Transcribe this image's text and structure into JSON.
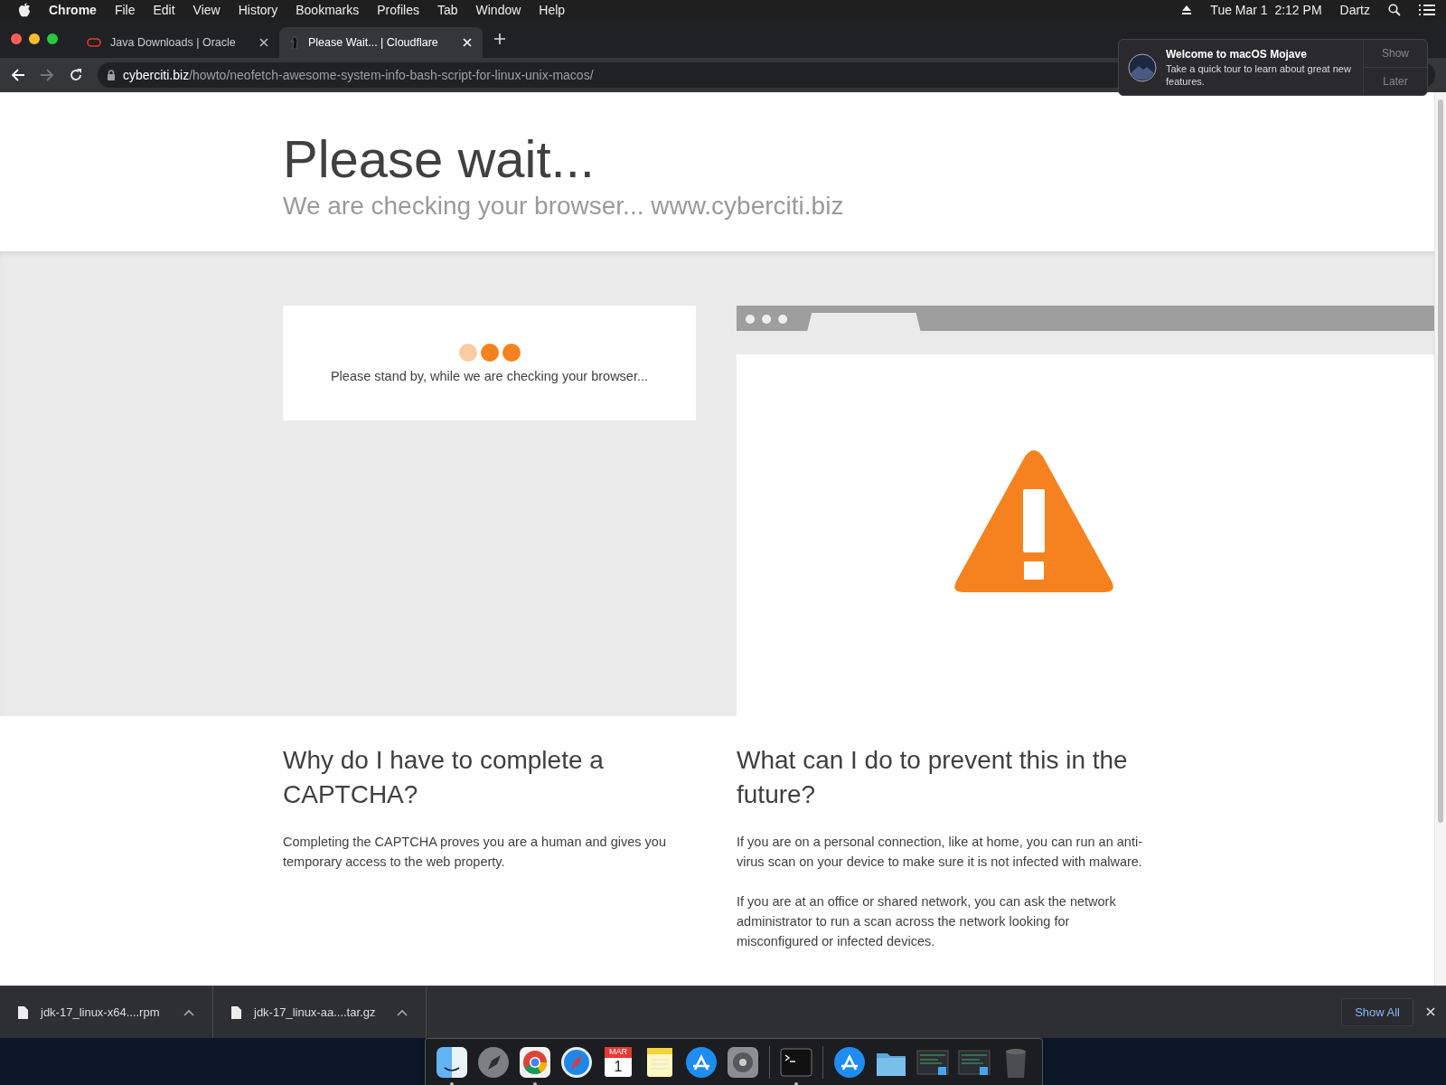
{
  "menu_bar": {
    "app": "Chrome",
    "items": [
      "File",
      "Edit",
      "View",
      "History",
      "Bookmarks",
      "Profiles",
      "Tab",
      "Window",
      "Help"
    ],
    "clock": "Tue Mar 1  2:12 PM",
    "user": "Dartz"
  },
  "tabs": [
    {
      "title": "Java Downloads | Oracle",
      "kind": "oracle",
      "selected": false
    },
    {
      "title": "Please Wait... | Cloudflare",
      "kind": "cloudflare",
      "selected": true
    }
  ],
  "address": {
    "host": "cyberciti.biz",
    "path": "/howto/neofetch-awesome-system-info-bash-script-for-linux-unix-macos/"
  },
  "notification": {
    "title": "Welcome to macOS Mojave",
    "body": "Take a quick tour to learn about great new features.",
    "buttons": [
      "Show",
      "Later"
    ]
  },
  "page": {
    "title": "Please wait...",
    "subtitle": "We are checking your browser... www.cyberciti.biz",
    "status": "Please stand by, while we are checking your browser...",
    "dots": [
      {
        "color": "#fbcba3"
      },
      {
        "color": "#f6821f"
      },
      {
        "color": "#f6821f"
      }
    ],
    "sections": [
      {
        "heading": "Why do I have to complete a CAPTCHA?",
        "paragraphs": [
          "Completing the CAPTCHA proves you are a human and gives you temporary access to the web property."
        ]
      },
      {
        "heading": "What can I do to prevent this in the future?",
        "paragraphs": [
          "If you are on a personal connection, like at home, you can run an anti-virus scan on your device to make sure it is not infected with malware.",
          "If you are at an office or shared network, you can ask the network administrator to run a scan across the network looking for misconfigured or infected devices."
        ]
      }
    ]
  },
  "downloads": {
    "files": [
      "jdk-17_linux-x64....rpm",
      "jdk-17_linux-aa....tar.gz"
    ],
    "show_all": "Show All"
  },
  "dock": [
    {
      "kind": "finder",
      "running": true
    },
    {
      "kind": "launchpad",
      "running": false
    },
    {
      "kind": "chrome",
      "running": true
    },
    {
      "kind": "safari",
      "running": false
    },
    {
      "kind": "calendar",
      "running": false,
      "month": "MAR",
      "day": "1"
    },
    {
      "kind": "notes",
      "running": false
    },
    {
      "kind": "appstore",
      "running": false
    },
    {
      "kind": "settings",
      "running": false
    },
    {
      "kind": "separator"
    },
    {
      "kind": "terminal",
      "running": true
    },
    {
      "kind": "separator"
    },
    {
      "kind": "appstore",
      "running": false
    },
    {
      "kind": "folder",
      "running": false
    },
    {
      "kind": "window",
      "running": false
    },
    {
      "kind": "window",
      "running": false
    },
    {
      "kind": "trash",
      "running": false
    }
  ]
}
